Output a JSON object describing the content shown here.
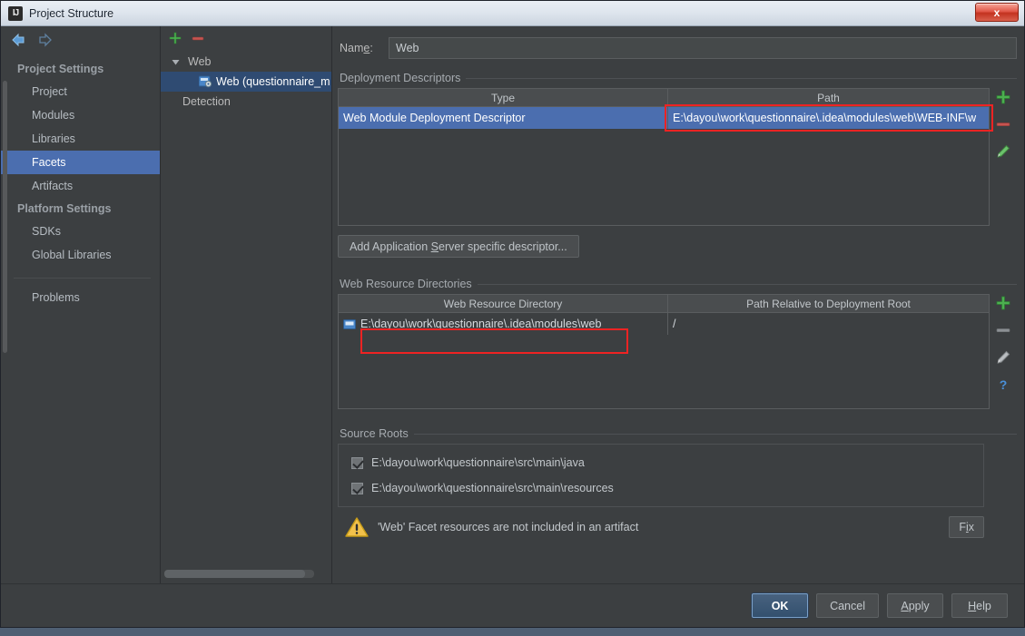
{
  "window": {
    "title": "Project Structure",
    "icon": "intellij-idea-icon",
    "close_label": "x"
  },
  "nav": {
    "back": "back-arrow",
    "forward": "forward-arrow"
  },
  "sidebar": {
    "groups": [
      {
        "label": "Project Settings",
        "items": [
          {
            "label": "Project",
            "selected": false
          },
          {
            "label": "Modules",
            "selected": false
          },
          {
            "label": "Libraries",
            "selected": false
          },
          {
            "label": "Facets",
            "selected": true
          },
          {
            "label": "Artifacts",
            "selected": false
          }
        ]
      },
      {
        "label": "Platform Settings",
        "items": [
          {
            "label": "SDKs",
            "selected": false
          },
          {
            "label": "Global Libraries",
            "selected": false
          }
        ]
      }
    ],
    "extra_items": [
      {
        "label": "Problems",
        "selected": false
      }
    ]
  },
  "tree": {
    "toolbar": {
      "add": "plus-icon",
      "remove": "minus-icon"
    },
    "nodes": [
      {
        "label": "Web",
        "level": 0,
        "expanded": true,
        "icon": null,
        "selected": false
      },
      {
        "label": "Web (questionnaire_m",
        "level": 1,
        "expanded": false,
        "icon": "web-facet-icon",
        "selected": true
      },
      {
        "label": "Detection",
        "level": 0,
        "expanded": false,
        "icon": null,
        "selected": false
      }
    ]
  },
  "main": {
    "name": {
      "label_pre": "Nam",
      "label_mnemonic": "e",
      "label_post": ":",
      "value": "Web"
    },
    "deployment_descriptors": {
      "title": "Deployment Descriptors",
      "columns": [
        "Type",
        "Path"
      ],
      "rows": [
        {
          "type": "Web Module Deployment Descriptor",
          "path": "E:\\dayou\\work\\questionnaire\\.idea\\modules\\web\\WEB-INF\\w",
          "selected": true
        }
      ],
      "tools": [
        "plus-icon",
        "minus-icon",
        "pencil-icon"
      ],
      "add_descriptor_button": {
        "pre": "Add Application ",
        "mnemonic": "S",
        "post": "erver specific descriptor..."
      }
    },
    "web_resource_directories": {
      "title": "Web Resource Directories",
      "columns": [
        "Web Resource Directory",
        "Path Relative to Deployment Root"
      ],
      "rows": [
        {
          "directory": "E:\\dayou\\work\\questionnaire\\.idea\\modules\\web",
          "relative": "/",
          "icon": "folder-icon",
          "selected": false
        }
      ],
      "tools": [
        "plus-icon",
        "minus-icon",
        "pencil-icon",
        "question-icon"
      ]
    },
    "source_roots": {
      "title": "Source Roots",
      "items": [
        {
          "label": "E:\\dayou\\work\\questionnaire\\src\\main\\java",
          "checked": true
        },
        {
          "label": "E:\\dayou\\work\\questionnaire\\src\\main\\resources",
          "checked": true
        }
      ]
    },
    "warning": {
      "icon": "warning-triangle-icon",
      "text": "'Web' Facet resources are not included in an artifact",
      "fix_pre": "F",
      "fix_mnemonic": "i",
      "fix_post": "x"
    }
  },
  "footer": {
    "buttons": [
      {
        "label": "OK",
        "pre": "OK",
        "mnemonic": "",
        "post": "",
        "primary": true
      },
      {
        "label": "Cancel",
        "pre": "Cancel",
        "mnemonic": "",
        "post": "",
        "primary": false
      },
      {
        "label": "Apply",
        "pre": "",
        "mnemonic": "A",
        "post": "pply",
        "primary": false
      },
      {
        "label": "Help",
        "pre": "",
        "mnemonic": "H",
        "post": "elp",
        "primary": false
      }
    ]
  },
  "colors": {
    "accent_selection": "#4b6eaf",
    "tree_selection": "#2f4b72",
    "highlight_box": "#ef2323",
    "warning": "#f0c000",
    "add_icon": "#4caf50",
    "remove_icon": "#c75450",
    "window_bg": "#3c3f41"
  }
}
